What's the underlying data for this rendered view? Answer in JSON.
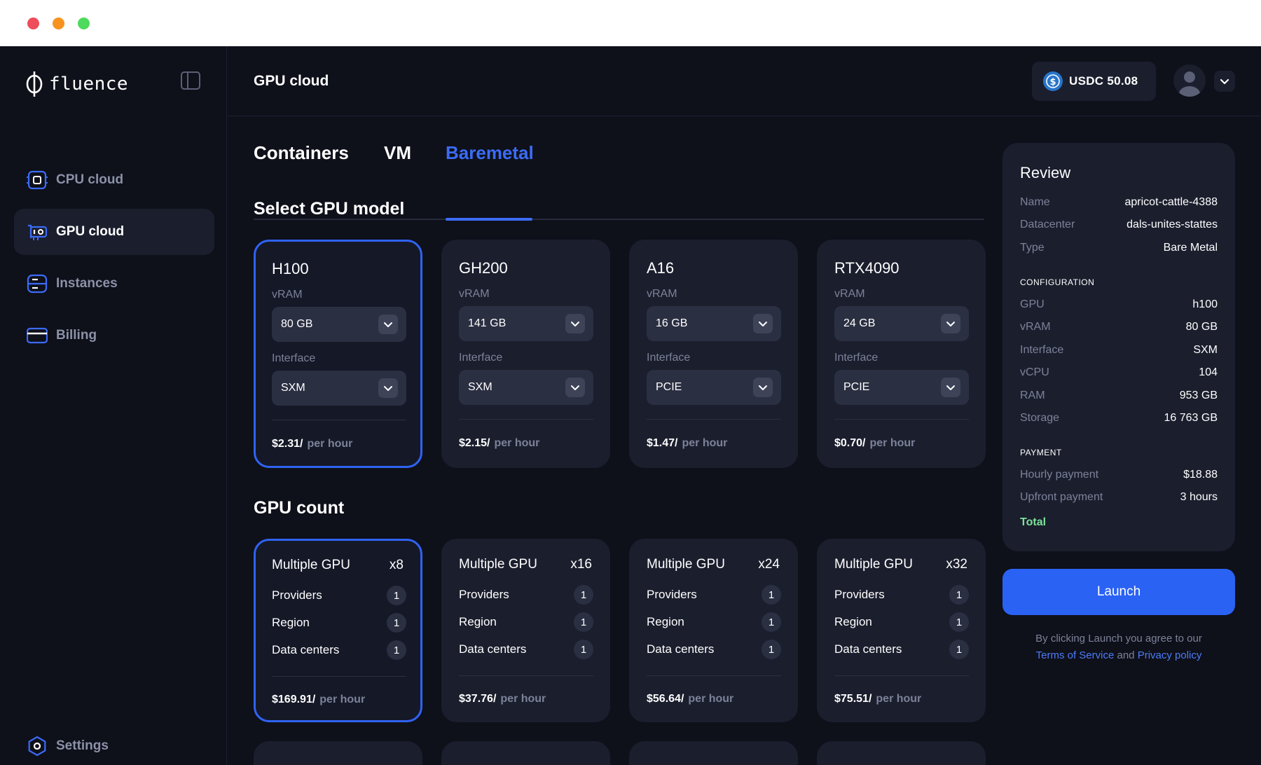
{
  "app": {
    "logo_text": "fluence"
  },
  "sidebar": {
    "items": [
      {
        "label": "CPU cloud",
        "icon": "cpu-icon"
      },
      {
        "label": "GPU cloud",
        "icon": "gpu-icon",
        "active": true
      },
      {
        "label": "Instances",
        "icon": "server-icon"
      },
      {
        "label": "Billing",
        "icon": "credit-card-icon"
      }
    ],
    "settings_label": "Settings"
  },
  "header": {
    "title": "GPU cloud",
    "balance": "USDC 50.08"
  },
  "tabs": [
    {
      "label": "Containers"
    },
    {
      "label": "VM"
    },
    {
      "label": "Baremetal",
      "active": true
    }
  ],
  "gpu_model": {
    "title": "Select GPU model",
    "vram_label": "vRAM",
    "interface_label": "Interface",
    "price_unit": "per hour",
    "cards": [
      {
        "name": "H100",
        "vram": "80 GB",
        "interface": "SXM",
        "price": "$2.31/",
        "selected": true
      },
      {
        "name": "GH200",
        "vram": "141 GB",
        "interface": "SXM",
        "price": "$2.15/"
      },
      {
        "name": "A16",
        "vram": "16 GB",
        "interface": "PCIE",
        "price": "$1.47/"
      },
      {
        "name": "RTX4090",
        "vram": "24 GB",
        "interface": "PCIE",
        "price": "$0.70/"
      }
    ]
  },
  "gpu_count": {
    "title": "GPU count",
    "providers_label": "Providers",
    "region_label": "Region",
    "datacenters_label": "Data centers",
    "price_unit": "per hour",
    "cards": [
      {
        "name": "Multiple GPU",
        "mult": "x8",
        "providers": "1",
        "region": "1",
        "datacenters": "1",
        "price": "$169.91/",
        "selected": true
      },
      {
        "name": "Multiple GPU",
        "mult": "x16",
        "providers": "1",
        "region": "1",
        "datacenters": "1",
        "price": "$37.76/"
      },
      {
        "name": "Multiple GPU",
        "mult": "x24",
        "providers": "1",
        "region": "1",
        "datacenters": "1",
        "price": "$56.64/"
      },
      {
        "name": "Multiple GPU",
        "mult": "x32",
        "providers": "1",
        "region": "1",
        "datacenters": "1",
        "price": "$75.51/"
      }
    ]
  },
  "review": {
    "title": "Review",
    "summary": [
      {
        "k": "Name",
        "v": "apricot-cattle-4388"
      },
      {
        "k": "Datacenter",
        "v": "dals-unites-stattes"
      },
      {
        "k": "Type",
        "v": "Bare Metal"
      }
    ],
    "config_heading": "CONFIGURATION",
    "config": [
      {
        "k": "GPU",
        "v": "h100"
      },
      {
        "k": "vRAM",
        "v": "80 GB"
      },
      {
        "k": "Interface",
        "v": "SXM"
      },
      {
        "k": "vCPU",
        "v": "104"
      },
      {
        "k": "RAM",
        "v": "953 GB"
      },
      {
        "k": "Storage",
        "v": "16 763 GB"
      }
    ],
    "payment_heading": "PAYMENT",
    "payment": [
      {
        "k": "Hourly payment",
        "v": "$18.88"
      },
      {
        "k": "Upfront payment",
        "v": "3 hours"
      }
    ],
    "total_label": "Total"
  },
  "launch": {
    "label": "Launch",
    "legal_prefix": "By clicking Launch you agree to our",
    "tos": "Terms of Service",
    "and": "and",
    "privacy": "Privacy policy"
  },
  "colors": {
    "accent": "#2a62f4",
    "background": "#0e101a",
    "card": "#1b1e2d",
    "total": "#7ce29a"
  }
}
